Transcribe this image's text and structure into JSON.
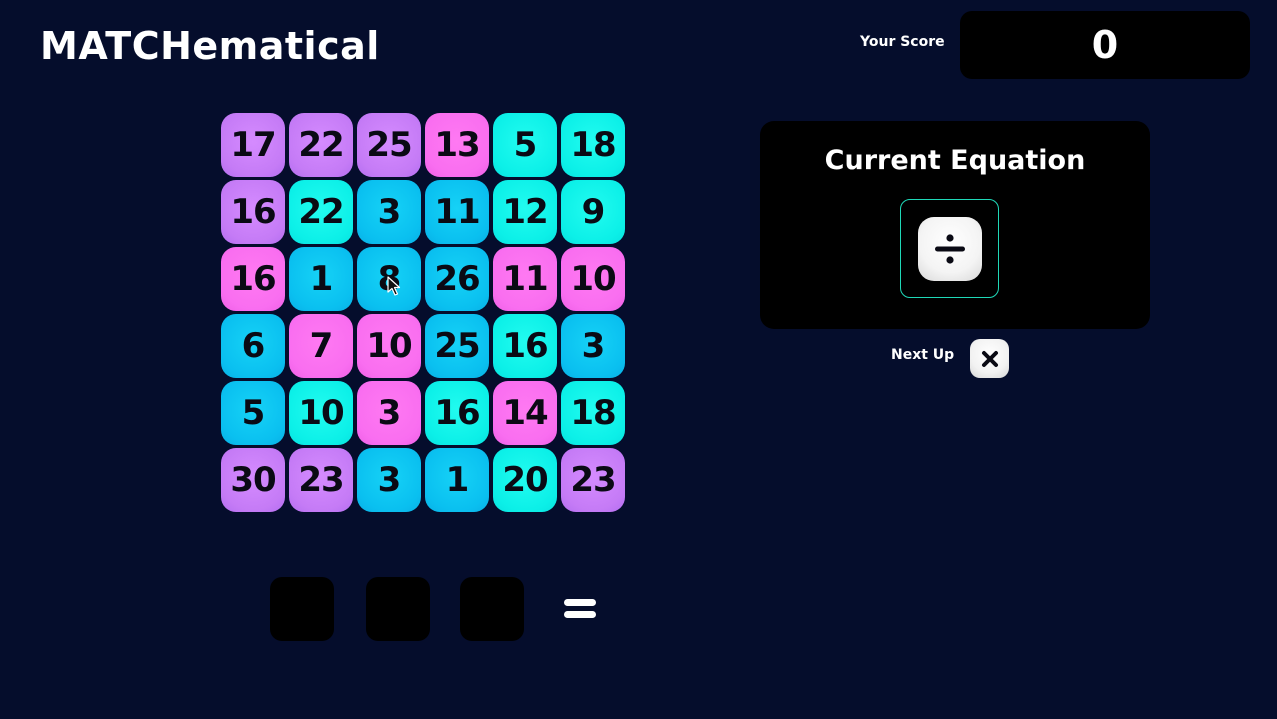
{
  "header": {
    "title": "MATCHematical",
    "score_label": "Your Score",
    "score_value": "0"
  },
  "board": {
    "rows": [
      [
        {
          "v": "17",
          "c": "purple"
        },
        {
          "v": "22",
          "c": "purple"
        },
        {
          "v": "25",
          "c": "purple"
        },
        {
          "v": "13",
          "c": "pink"
        },
        {
          "v": "5",
          "c": "cyan"
        },
        {
          "v": "18",
          "c": "cyan"
        }
      ],
      [
        {
          "v": "16",
          "c": "purple"
        },
        {
          "v": "22",
          "c": "cyan"
        },
        {
          "v": "3",
          "c": "blue"
        },
        {
          "v": "11",
          "c": "blue"
        },
        {
          "v": "12",
          "c": "cyan"
        },
        {
          "v": "9",
          "c": "cyan"
        }
      ],
      [
        {
          "v": "16",
          "c": "pink"
        },
        {
          "v": "1",
          "c": "blue"
        },
        {
          "v": "8",
          "c": "blue"
        },
        {
          "v": "26",
          "c": "blue"
        },
        {
          "v": "11",
          "c": "pink"
        },
        {
          "v": "10",
          "c": "pink"
        }
      ],
      [
        {
          "v": "6",
          "c": "blue"
        },
        {
          "v": "7",
          "c": "pink"
        },
        {
          "v": "10",
          "c": "pink"
        },
        {
          "v": "25",
          "c": "blue"
        },
        {
          "v": "16",
          "c": "cyan"
        },
        {
          "v": "3",
          "c": "blue"
        }
      ],
      [
        {
          "v": "5",
          "c": "blue"
        },
        {
          "v": "10",
          "c": "cyan"
        },
        {
          "v": "3",
          "c": "pink"
        },
        {
          "v": "16",
          "c": "cyan"
        },
        {
          "v": "14",
          "c": "pink"
        },
        {
          "v": "18",
          "c": "cyan"
        }
      ],
      [
        {
          "v": "30",
          "c": "purple"
        },
        {
          "v": "23",
          "c": "purple"
        },
        {
          "v": "3",
          "c": "blue"
        },
        {
          "v": "1",
          "c": "blue"
        },
        {
          "v": "20",
          "c": "cyan"
        },
        {
          "v": "23",
          "c": "purple"
        }
      ]
    ]
  },
  "equation": {
    "title": "Current Equation",
    "operator_icon": "divide-icon",
    "next_label": "Next Up",
    "next_operator_icon": "multiply-icon",
    "slots": [
      "",
      "",
      ""
    ],
    "equals_icon": "equals-icon"
  },
  "colors": {
    "background": "#050d2c",
    "purple": "#c57bf6",
    "pink": "#f96ef0",
    "cyan": "#0cf0e8",
    "blue": "#0ac0f0",
    "frame_accent": "#1fd8b8"
  }
}
